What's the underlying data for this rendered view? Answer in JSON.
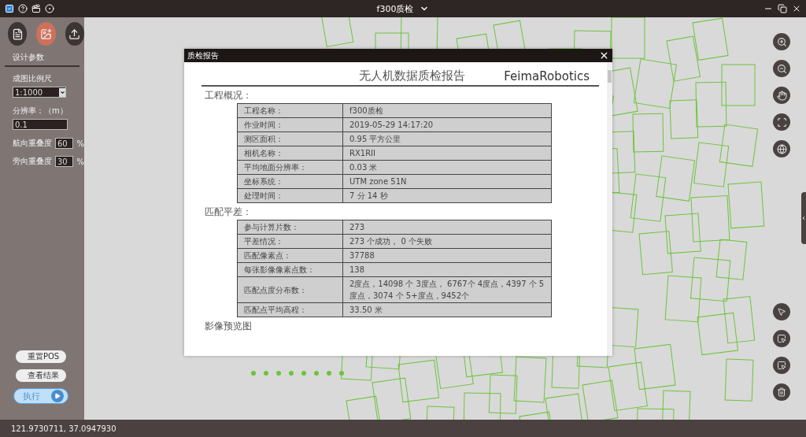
{
  "app_title": "f300质检",
  "left_panel": {
    "tabs": [
      {
        "selected": false
      },
      {
        "selected": true
      },
      {
        "selected": false
      }
    ],
    "section_title": "设计参数",
    "fields": [
      {
        "kind": "select",
        "label": "成图比例尺",
        "value": "1:1000"
      },
      {
        "kind": "text",
        "label": "分辨率：（m）",
        "value": "0.1"
      },
      {
        "kind": "inline",
        "label": "航向重叠度",
        "value": "60",
        "unit": "%"
      },
      {
        "kind": "inline",
        "label": "旁向重叠度",
        "value": "30",
        "unit": "%"
      }
    ],
    "buttons": [
      {
        "kind": "plain",
        "label": "重置POS"
      },
      {
        "kind": "plain",
        "label": "查看结果"
      },
      {
        "kind": "primary",
        "label": "执行"
      }
    ]
  },
  "report_dialog": {
    "title": "质检报告",
    "heading": "无人机数据质检报告",
    "brand": "FeimaRobotics",
    "sections": [
      {
        "title": "工程概况：",
        "rows": [
          [
            "工程名称：",
            "f300质检"
          ],
          [
            "作业时间：",
            "2019-05-29 14:17:20"
          ],
          [
            "测区面积：",
            "0.95 平方公里"
          ],
          [
            "相机名称：",
            "RX1RII"
          ],
          [
            "平均地面分辨率：",
            "0.03 米"
          ],
          [
            "坐标系统：",
            "UTM zone 51N"
          ],
          [
            "处理时间：",
            "7 分 14 秒"
          ]
        ]
      },
      {
        "title": "匹配平差：",
        "rows": [
          [
            "参与计算片数：",
            "273"
          ],
          [
            "平差情况：",
            "273 个成功， 0 个失败"
          ],
          [
            "匹配像素点：",
            "37788"
          ],
          [
            "每张影像像素点数：",
            "138"
          ],
          [
            "匹配点度分布数：",
            "2度点，14098 个 3度点， 6767个 4度点，4397 个 5度点，3074 个 5+度点，9452个"
          ],
          [
            "匹配点平均高程：",
            "33.50 米"
          ]
        ]
      },
      {
        "title": "影像预览图"
      }
    ]
  },
  "status_bar": {
    "coordinates": "121.9730711, 37.0947930"
  }
}
